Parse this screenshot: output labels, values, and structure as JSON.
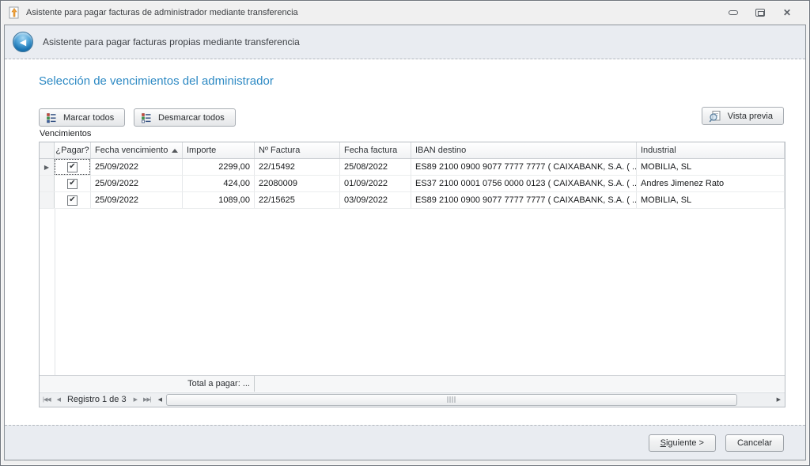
{
  "window": {
    "title": "Asistente para pagar facturas de administrador mediante transferencia"
  },
  "header": {
    "title": "Asistente para pagar facturas propias mediante transferencia"
  },
  "content": {
    "section_title": "Selección de vencimientos del administrador",
    "toolbar": {
      "mark_all_label": "Marcar todos",
      "unmark_all_label": "Desmarcar todos",
      "preview_label": "Vista previa"
    },
    "grid_label": "Vencimientos",
    "grid": {
      "columns": [
        "¿Pagar?",
        "Fecha vencimiento",
        "Importe",
        "Nº Factura",
        "Fecha factura",
        "IBAN destino",
        "Industrial"
      ],
      "sort_column": "Fecha vencimiento",
      "sort_direction": "ascending",
      "rows": [
        {
          "pagar": true,
          "fecha_vencimiento": "25/09/2022",
          "importe": "2299,00",
          "num_factura": "22/15492",
          "fecha_factura": "25/08/2022",
          "iban": "ES89 2100 0900 9077 7777 7777 ( CAIXABANK, S.A. ( ...",
          "industrial": "MOBILIA, SL"
        },
        {
          "pagar": true,
          "fecha_vencimiento": "25/09/2022",
          "importe": "424,00",
          "num_factura": "22080009",
          "fecha_factura": "01/09/2022",
          "iban": "ES37 2100 0001 0756 0000 0123 ( CAIXABANK, S.A. ( ...",
          "industrial": "Andres Jimenez Rato"
        },
        {
          "pagar": true,
          "fecha_vencimiento": "25/09/2022",
          "importe": "1089,00",
          "num_factura": "22/15625",
          "fecha_factura": "03/09/2022",
          "iban": "ES89 2100 0900 9077 7777 7777 ( CAIXABANK, S.A. ( ...",
          "industrial": "MOBILIA, SL"
        }
      ],
      "footer_total_label": "Total a pagar: ...",
      "navigator_label": "Registro 1 de 3"
    }
  },
  "footer": {
    "next_label": "Siguiente >",
    "cancel_label": "Cancelar"
  },
  "colors": {
    "section_title": "#2e8ac4",
    "strip_background": "#e9ecf1",
    "back_button_blue": "#1a74b2"
  },
  "icons": {
    "close": "✕",
    "back": "◀",
    "sort_ascending": "▲",
    "row_indicator": "▶",
    "checkbox_checked": "✔",
    "nav_first": "|◀◀",
    "nav_prev": "◀",
    "nav_next": "▶",
    "nav_last": "▶▶|",
    "scroll_left": "◀",
    "scroll_right": "▶"
  }
}
